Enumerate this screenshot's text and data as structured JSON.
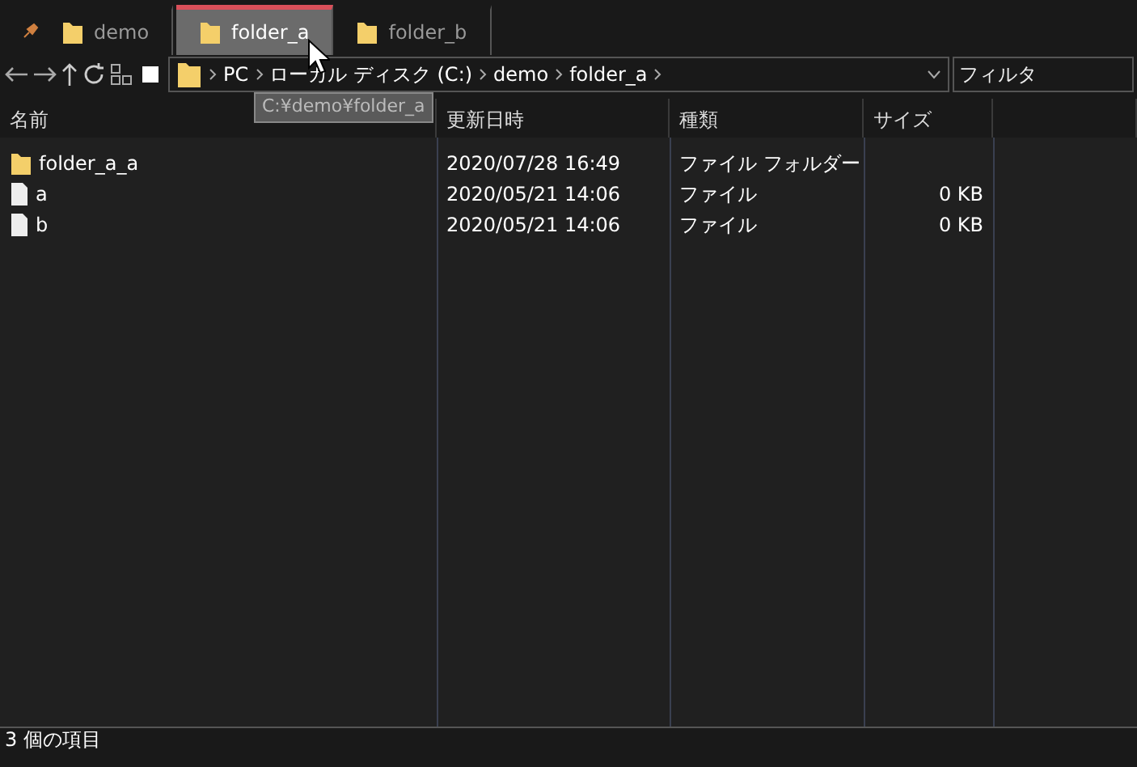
{
  "tabs": [
    {
      "label": "demo",
      "selected": false,
      "pinned": true
    },
    {
      "label": "folder_a",
      "selected": true,
      "pinned": false
    },
    {
      "label": "folder_b",
      "selected": false,
      "pinned": false
    }
  ],
  "address": {
    "breadcrumb": [
      "PC",
      "ローカル ディスク (C:)",
      "demo",
      "folder_a"
    ],
    "tooltip": "C:¥demo¥folder_a"
  },
  "filter": {
    "placeholder": "フィルタ"
  },
  "table": {
    "columns": [
      "名前",
      "更新日時",
      "種類",
      "サイズ"
    ],
    "rows": [
      {
        "kind": "folder",
        "name": "folder_a_a",
        "modified": "2020/07/28 16:49",
        "type": "ファイル フォルダー",
        "size": ""
      },
      {
        "kind": "file",
        "name": "a",
        "modified": "2020/05/21 14:06",
        "type": "ファイル",
        "size": "0 KB"
      },
      {
        "kind": "file",
        "name": "b",
        "modified": "2020/05/21 14:06",
        "type": "ファイル",
        "size": "0 KB"
      }
    ]
  },
  "status_bar": "3 個の項目"
}
